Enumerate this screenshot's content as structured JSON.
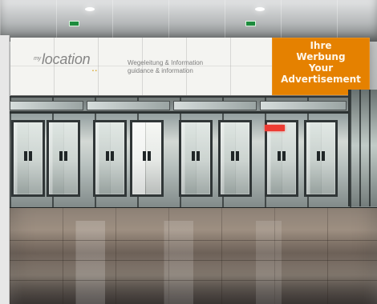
{
  "scene": {
    "type": "photograph",
    "subject": "airport terminal glass doors with digital advertising display"
  },
  "display": {
    "logo": {
      "prefix": "my",
      "name": "location",
      "dots": ".."
    },
    "info": {
      "german": "Wegeleitung & Information",
      "english": "guidance & information"
    },
    "advertisement": {
      "line1": "Ihre",
      "line2": "Werbung",
      "line3": "Your",
      "line4": "Advertisement"
    }
  },
  "colors": {
    "advertisement_orange": "#e58100",
    "logo_gray": "#858585",
    "led_panel": "#f4f4f1",
    "exit_sign_green": "#1d8b3d",
    "red_sign": "#ed3b33"
  }
}
